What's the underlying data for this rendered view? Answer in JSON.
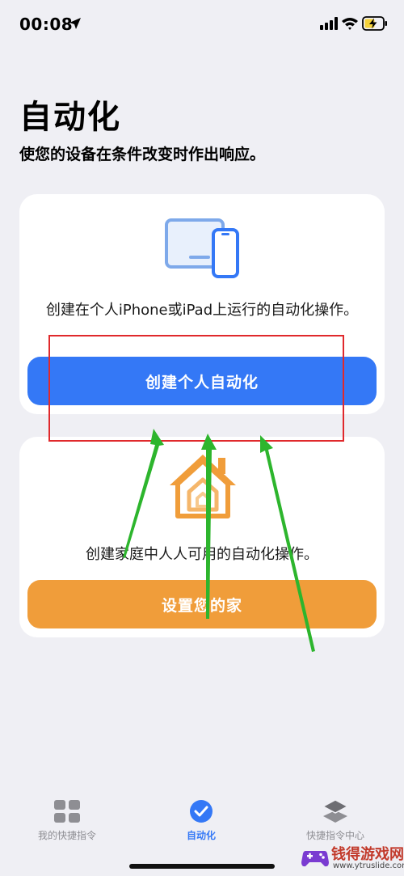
{
  "status_bar": {
    "time": "00:08"
  },
  "header": {
    "title": "自动化",
    "subtitle": "使您的设备在条件改变时作出响应。"
  },
  "personal_card": {
    "description": "创建在个人iPhone或iPad上运行的自动化操作。",
    "button_label": "创建个人自动化",
    "button_color": "#3478f6"
  },
  "home_card": {
    "description": "创建家庭中人人可用的自动化操作。",
    "button_label": "设置您的家",
    "button_color": "#f09d3a"
  },
  "annotation": {
    "box_color": "#e0292c",
    "arrow_color": "#2db52d"
  },
  "tab_bar": {
    "tabs": [
      {
        "label": "我的快捷指令",
        "icon": "grid-icon",
        "active": false
      },
      {
        "label": "自动化",
        "icon": "clock-check-icon",
        "active": true
      },
      {
        "label": "快捷指令中心",
        "icon": "layers-icon",
        "active": false
      }
    ]
  },
  "watermark": {
    "title": "钱得游戏网",
    "url": "www.ytruslide.com"
  }
}
